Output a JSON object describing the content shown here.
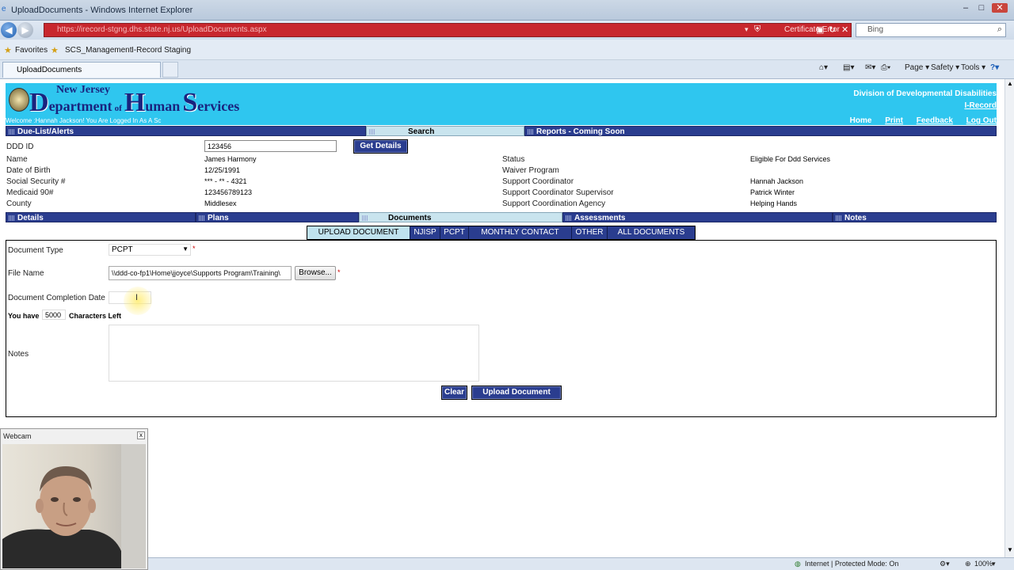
{
  "browser": {
    "window_title": "UploadDocuments - Windows Internet Explorer",
    "url": "https://irecord-stgng.dhs.state.nj.us/UploadDocuments.aspx",
    "cert_error": "Certificate Error",
    "search_placeholder": "Bing",
    "favorites_label": "Favorites",
    "fav_links": [
      "SCS_Management",
      "I-Record Staging"
    ],
    "tab_title": "UploadDocuments",
    "cmd": {
      "page": "Page",
      "safety": "Safety",
      "tools": "Tools"
    },
    "status_zone": "Internet | Protected Mode: On",
    "zoom": "100%"
  },
  "header": {
    "logo_small1": "New Jersey",
    "logo_D": "D",
    "logo_epartment": "epartment",
    "logo_of": "of",
    "logo_H": "H",
    "logo_uman": "uman",
    "logo_S": "S",
    "logo_ervices": "ervices",
    "welcome": "Welcome :Hannah Jackson! You Are Logged In As A Sc",
    "division": "Division of Developmental Disabilities",
    "app": "I-Record",
    "links": [
      "Home",
      "Print",
      "Feedback",
      "Log Out"
    ]
  },
  "topnav": [
    "Due-List/Alerts",
    "Search",
    "Reports - Coming Soon"
  ],
  "lookup": {
    "label": "DDD ID",
    "value": "123456",
    "button": "Get Details"
  },
  "client": {
    "left": [
      {
        "label": "Name",
        "value": "James Harmony"
      },
      {
        "label": "Date of Birth",
        "value": "12/25/1991"
      },
      {
        "label": "Social Security #",
        "value": "*** - ** - 4321"
      },
      {
        "label": "Medicaid 90#",
        "value": "123456789123"
      },
      {
        "label": "County",
        "value": "Middlesex"
      }
    ],
    "right": [
      {
        "label": "Status",
        "value": "Eligible For Ddd Services"
      },
      {
        "label": "Waiver Program",
        "value": ""
      },
      {
        "label": "Support Coordinator",
        "value": "Hannah Jackson"
      },
      {
        "label": "Support Coordinator Supervisor",
        "value": "Patrick Winter"
      },
      {
        "label": "Support Coordination Agency",
        "value": "Helping Hands"
      }
    ]
  },
  "sectionnav": [
    "Details",
    "Plans",
    "Documents",
    "Assessments",
    "Notes"
  ],
  "doctabs": [
    "UPLOAD DOCUMENT",
    "NJISP",
    "PCPT",
    "MONTHLY CONTACT",
    "OTHER",
    "ALL DOCUMENTS"
  ],
  "form": {
    "doc_type_label": "Document Type",
    "doc_type_value": "PCPT",
    "file_label": "File Name",
    "file_value": "\\\\ddd-co-fp1\\Home\\jjoyce\\Supports Program\\Training\\",
    "browse": "Browse...",
    "completion_label": "Document Completion Date",
    "completion_value": "",
    "you_have": "You have",
    "chars": "5000",
    "chars_left": "Characters Left",
    "notes_label": "Notes",
    "required_mark": "*",
    "clear": "Clear",
    "upload": "Upload Document"
  },
  "webcam": {
    "title": "Webcam"
  },
  "colors": {
    "banner": "#2fc6ef",
    "nav": "#2a3d8f",
    "active_tab": "#c9e4ee",
    "addressbar_error": "#c8272e"
  }
}
